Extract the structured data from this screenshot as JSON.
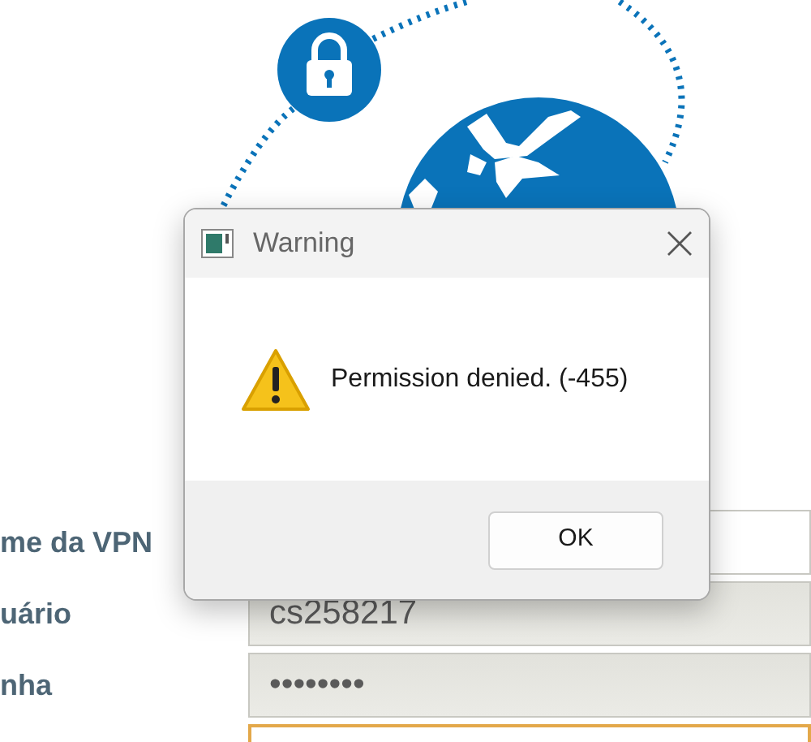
{
  "dialog": {
    "title": "Warning",
    "message": "Permission denied. (-455)",
    "button": "OK"
  },
  "form": {
    "fields": [
      {
        "label": "me da VPN",
        "readonly": false,
        "focused": false
      },
      {
        "label": "uário",
        "value": "cs258217",
        "readonly": true,
        "focused": false
      },
      {
        "label": "nha",
        "value": "••••••••",
        "readonly": true,
        "focused": false
      },
      {
        "readonly": false,
        "focused": true
      }
    ]
  }
}
